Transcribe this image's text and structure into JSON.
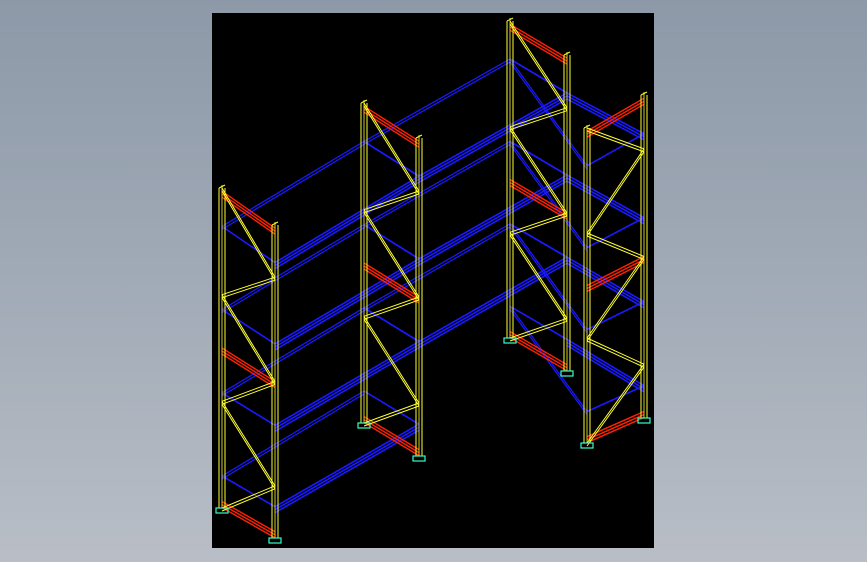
{
  "window": {
    "background_gradient": [
      "#8d99a8",
      "#b9bec6"
    ]
  },
  "drawing": {
    "subject": "pallet-rack-wireframe",
    "background_color": "#000000",
    "colors": {
      "uprights": "#ffff33",
      "beams": "#1a1aff",
      "end_ties": "#ff2200",
      "base_plates": "#33ffcc"
    },
    "bays": 3,
    "shelf_levels_per_bay": 3,
    "frames": 4
  }
}
